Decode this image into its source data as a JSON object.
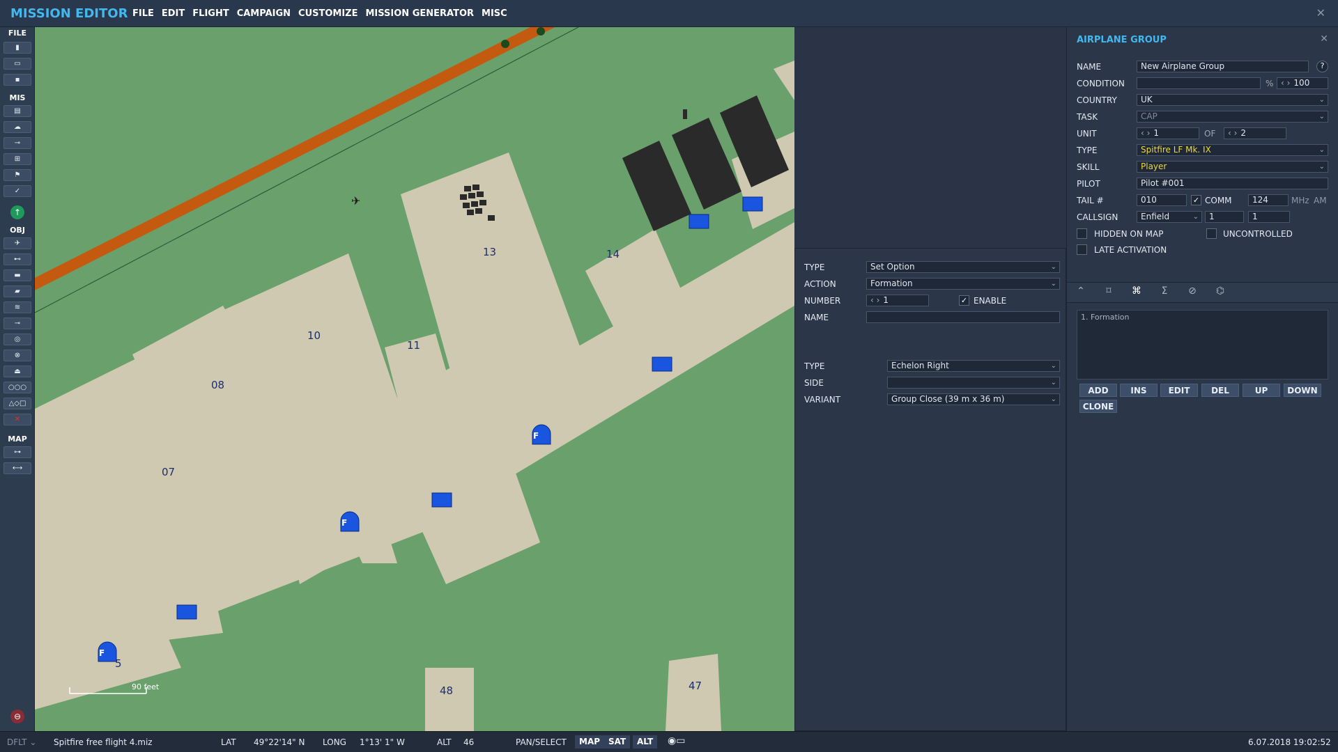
{
  "app": {
    "title": "MISSION EDITOR",
    "menu": [
      "FILE",
      "EDIT",
      "FLIGHT",
      "CAMPAIGN",
      "CUSTOMIZE",
      "MISSION GENERATOR",
      "MISC"
    ]
  },
  "toolbar": {
    "sections": {
      "file": "FILE",
      "mis": "MIS",
      "obj": "OBJ",
      "map": "MAP"
    }
  },
  "map": {
    "labels": [
      "13",
      "14",
      "10",
      "11",
      "08",
      "07",
      "48",
      "47",
      "5"
    ],
    "marker_letter": "F",
    "scale": "90 feet"
  },
  "action_panel": {
    "type_label": "TYPE",
    "type_value": "Set Option",
    "action_label": "ACTION",
    "action_value": "Formation",
    "number_label": "NUMBER",
    "number_value": "1",
    "enable_label": "ENABLE",
    "name_label": "NAME",
    "name_value": "",
    "type2_label": "TYPE",
    "type2_value": "Echelon Right",
    "side_label": "SIDE",
    "side_value": "",
    "variant_label": "VARIANT",
    "variant_value": "Group Close (39 m x 36 m)"
  },
  "group_panel": {
    "title": "AIRPLANE GROUP",
    "name_label": "NAME",
    "name_value": "New Airplane Group",
    "help": "?",
    "condition_label": "CONDITION",
    "condition_value": "",
    "condition_pct": "%",
    "condition_num": "100",
    "country_label": "COUNTRY",
    "country_value": "UK",
    "task_label": "TASK",
    "task_value": "CAP",
    "unit_label": "UNIT",
    "unit_value": "1",
    "unit_of": "OF",
    "unit_total": "2",
    "type_label": "TYPE",
    "type_value": "Spitfire LF Mk. IX",
    "skill_label": "SKILL",
    "skill_value": "Player",
    "pilot_label": "PILOT",
    "pilot_value": "Pilot #001",
    "tail_label": "TAIL #",
    "tail_value": "010",
    "comm_label": "COMM",
    "comm_value": "124",
    "mhz": "MHz",
    "am": "AM",
    "callsign_label": "CALLSIGN",
    "callsign_value": "Enfield",
    "callsign_n1": "1",
    "callsign_n2": "1",
    "hidden_label": "HIDDEN ON MAP",
    "uncontrolled_label": "UNCONTROLLED",
    "late_label": "LATE ACTIVATION",
    "list": [
      "1. Formation"
    ],
    "buttons": {
      "add": "ADD",
      "ins": "INS",
      "edit": "EDIT",
      "del": "DEL",
      "up": "UP",
      "down": "DOWN",
      "clone": "CLONE"
    }
  },
  "status": {
    "mode": "DFLT",
    "file": "Spitfire free flight 4.miz",
    "lat_label": "LAT",
    "lat": "49°22'14\" N",
    "long_label": "LONG",
    "long": "1°13' 1\" W",
    "alt_label": "ALT",
    "alt": "46",
    "pan": "PAN/SELECT",
    "map": "MAP",
    "sat": "SAT",
    "alt_btn": "ALT",
    "datetime": "6.07.2018 19:02:52"
  },
  "colors": {
    "accent": "#41b8ee",
    "map_ground": "#6aa06c",
    "apron": "#cfc9b2",
    "road": "#c45a10",
    "marker_blue": "#1a55e0",
    "marker_yellow": "#f0e020",
    "enemy_red": "#e03030"
  }
}
